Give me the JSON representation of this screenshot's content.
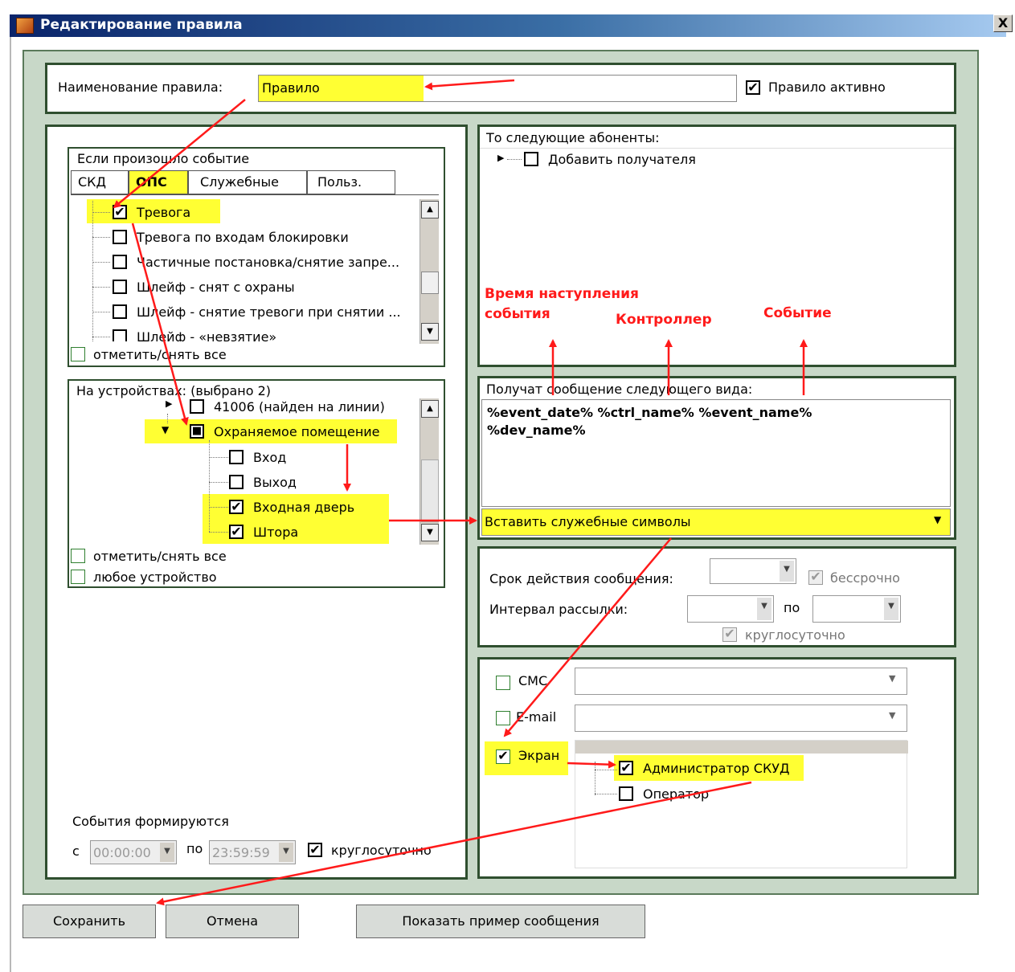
{
  "window": {
    "title": "Редактирование правила",
    "close_label": "X"
  },
  "rule": {
    "name_label": "Наименование правила:",
    "name_value": "Правило",
    "active_label": "Правило активно",
    "active_mark": "✔"
  },
  "events": {
    "group_label": "Если произошло событие",
    "tabs": [
      "СКД",
      "ОПС",
      "Служебные",
      "Польз."
    ],
    "items": [
      {
        "label": "Тревога",
        "checked": "✔"
      },
      {
        "label": "Тревога по входам блокировки",
        "checked": ""
      },
      {
        "label": "Частичные постановка/снятие запре...",
        "checked": ""
      },
      {
        "label": "Шлейф - снят с охраны",
        "checked": ""
      },
      {
        "label": "Шлейф - снятие тревоги при снятии ...",
        "checked": ""
      },
      {
        "label": "Шлейф - «невзятие»",
        "checked": ""
      }
    ],
    "toggle_all": "отметить/снять все"
  },
  "devices": {
    "group_label": "На устройствах: (выбрано 2)",
    "items": [
      {
        "label": "41006 (найден на линии)",
        "checked": ""
      },
      {
        "label": "Охраняемое помещение",
        "checked": "■"
      },
      {
        "label": "Вход",
        "checked": ""
      },
      {
        "label": "Выход",
        "checked": ""
      },
      {
        "label": "Входная дверь",
        "checked": "✔"
      },
      {
        "label": "Штора",
        "checked": "✔"
      }
    ],
    "toggle_all": "отметить/снять все",
    "any_device": "любое устройство"
  },
  "schedule": {
    "label": "События формируются",
    "from_label": "с",
    "from_value": "00:00:00",
    "to_label": "по",
    "to_value": "23:59:59",
    "allday_label": "круглосуточно",
    "allday_mark": "✔"
  },
  "recipients": {
    "label": "То следующие абоненты:",
    "add_label": "Добавить получателя"
  },
  "annotations": {
    "time": "Время наступления события",
    "controller": "Контроллер",
    "event": "Событие"
  },
  "message": {
    "label": "Получат сообщение следующего вида:",
    "text_line1": "%event_date% %ctrl_name% %event_name%",
    "text_line2": "%dev_name%",
    "insert_label": "Вставить служебные символы"
  },
  "validity": {
    "duration_label": "Срок действия сообщения:",
    "unlimited_label": "бессрочно",
    "interval_label": "Интервал рассылки:",
    "to_label": "по",
    "allday_label": "круглосуточно"
  },
  "channels": {
    "sms_label": "СМС",
    "email_label": "E-mail",
    "screen_label": "Экран",
    "screen_mark": "✔",
    "users": [
      {
        "label": "Администратор СКУД",
        "checked": "✔"
      },
      {
        "label": "Оператор",
        "checked": ""
      }
    ]
  },
  "buttons": {
    "save": "Сохранить",
    "cancel": "Отмена",
    "preview": "Показать пример сообщения"
  },
  "colors": {
    "highlight": "#ffff33",
    "annotation": "#ff1a1a",
    "frame": "#2f4f2f",
    "titlebar": "#0a246a"
  }
}
